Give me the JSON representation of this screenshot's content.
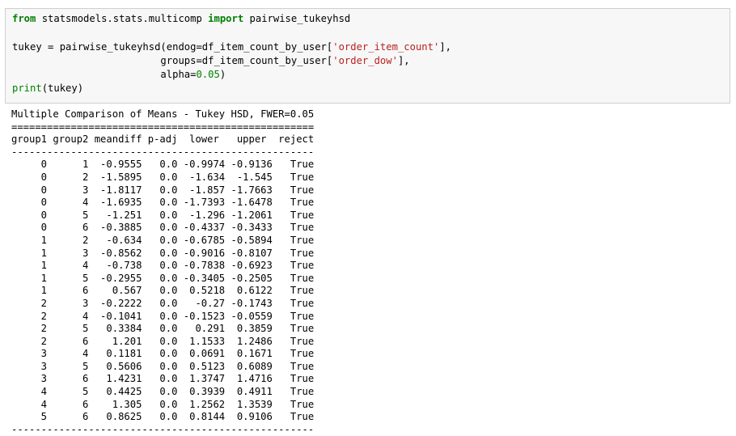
{
  "code_cell": {
    "line1": {
      "kw_from": "from",
      "module": " statsmodels.stats.multicomp ",
      "kw_import": "import",
      "name": " pairwise_tukeyhsd"
    },
    "line3": {
      "p1": "tukey = pairwise_tukeyhsd(endog=df_item_count_by_user[",
      "s1": "'order_item_count'",
      "p2": "],"
    },
    "line4": {
      "p1": "                         groups=df_item_count_by_user[",
      "s1": "'order_dow'",
      "p2": "],"
    },
    "line5": {
      "p1": "                         alpha=",
      "n1": "0.05",
      "p2": ")"
    },
    "line6": {
      "kw_print": "print",
      "rest": "(tukey)"
    }
  },
  "output": {
    "title": "Multiple Comparison of Means - Tukey HSD, FWER=0.05",
    "rule_double": "===================================================",
    "header": "group1 group2 meandiff p-adj  lower   upper  reject",
    "rule_single": "---------------------------------------------------",
    "columns": [
      "group1",
      "group2",
      "meandiff",
      "p-adj",
      "lower",
      "upper",
      "reject"
    ],
    "rows": [
      [
        "0",
        "1",
        "-0.9555",
        "0.0",
        "-0.9974",
        "-0.9136",
        "True"
      ],
      [
        "0",
        "2",
        "-1.5895",
        "0.0",
        "-1.634",
        "-1.545",
        "True"
      ],
      [
        "0",
        "3",
        "-1.8117",
        "0.0",
        "-1.857",
        "-1.7663",
        "True"
      ],
      [
        "0",
        "4",
        "-1.6935",
        "0.0",
        "-1.7393",
        "-1.6478",
        "True"
      ],
      [
        "0",
        "5",
        "-1.251",
        "0.0",
        "-1.296",
        "-1.2061",
        "True"
      ],
      [
        "0",
        "6",
        "-0.3885",
        "0.0",
        "-0.4337",
        "-0.3433",
        "True"
      ],
      [
        "1",
        "2",
        "-0.634",
        "0.0",
        "-0.6785",
        "-0.5894",
        "True"
      ],
      [
        "1",
        "3",
        "-0.8562",
        "0.0",
        "-0.9016",
        "-0.8107",
        "True"
      ],
      [
        "1",
        "4",
        "-0.738",
        "0.0",
        "-0.7838",
        "-0.6923",
        "True"
      ],
      [
        "1",
        "5",
        "-0.2955",
        "0.0",
        "-0.3405",
        "-0.2505",
        "True"
      ],
      [
        "1",
        "6",
        "0.567",
        "0.0",
        "0.5218",
        "0.6122",
        "True"
      ],
      [
        "2",
        "3",
        "-0.2222",
        "0.0",
        "-0.27",
        "-0.1743",
        "True"
      ],
      [
        "2",
        "4",
        "-0.1041",
        "0.0",
        "-0.1523",
        "-0.0559",
        "True"
      ],
      [
        "2",
        "5",
        "0.3384",
        "0.0",
        "0.291",
        "0.3859",
        "True"
      ],
      [
        "2",
        "6",
        "1.201",
        "0.0",
        "1.1533",
        "1.2486",
        "True"
      ],
      [
        "3",
        "4",
        "0.1181",
        "0.0",
        "0.0691",
        "0.1671",
        "True"
      ],
      [
        "3",
        "5",
        "0.5606",
        "0.0",
        "0.5123",
        "0.6089",
        "True"
      ],
      [
        "3",
        "6",
        "1.4231",
        "0.0",
        "1.3747",
        "1.4716",
        "True"
      ],
      [
        "4",
        "5",
        "0.4425",
        "0.0",
        "0.3939",
        "0.4911",
        "True"
      ],
      [
        "4",
        "6",
        "1.305",
        "0.0",
        "1.2562",
        "1.3539",
        "True"
      ],
      [
        "5",
        "6",
        "0.8625",
        "0.0",
        "0.8144",
        "0.9106",
        "True"
      ]
    ]
  }
}
